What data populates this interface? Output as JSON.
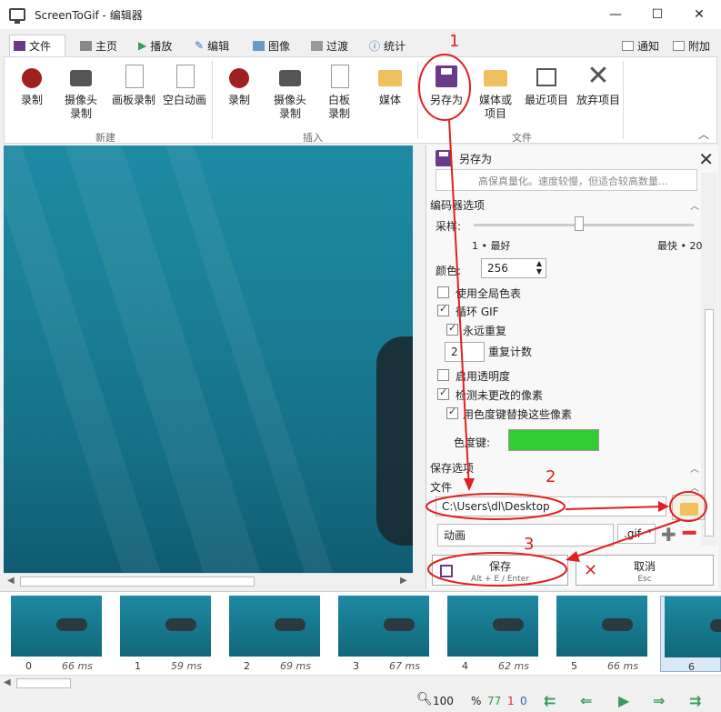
{
  "window": {
    "title": "ScreenToGif - 编辑器"
  },
  "tabs": [
    {
      "label": "文件"
    },
    {
      "label": "主页"
    },
    {
      "label": "播放"
    },
    {
      "label": "编辑"
    },
    {
      "label": "图像"
    },
    {
      "label": "过渡"
    },
    {
      "label": "统计"
    }
  ],
  "header_right": {
    "notify": "通知",
    "attach": "附加"
  },
  "ribbon": {
    "new": {
      "group": "新建",
      "items": [
        "录制",
        "摄像头\n录制",
        "画板录制",
        "空白动画"
      ]
    },
    "insert": {
      "group": "插入",
      "items": [
        "录制",
        "摄像头\n录制",
        "白板\n录制",
        "媒体"
      ]
    },
    "file": {
      "group": "文件",
      "items": [
        "另存为",
        "媒体或\n项目",
        "最近项目",
        "放弃项目"
      ]
    }
  },
  "panel": {
    "title": "另存为",
    "format_desc": "高保真量化。速度较慢，但适合较高数量...",
    "encoder_section": "编码器选项",
    "sampling_label": "采样:",
    "sampling_min": "1 • 最好",
    "sampling_max": "最快 • 20",
    "colors_label": "颜色:",
    "colors_value": "256",
    "use_global_palette": "使用全局色表",
    "loop_gif": "循环 GIF",
    "repeat_forever": "永远重复",
    "repeat_count_value": "2",
    "repeat_count_label": "重复计数",
    "enable_transparency": "启用透明度",
    "detect_unchanged": "检测未更改的像素",
    "replace_with_chroma": "用色度键替换这些像素",
    "chroma_key_label": "色度键:",
    "save_options_section": "保存选项",
    "file_section": "文件",
    "path_value": "C:\\Users\\dl\\Desktop",
    "filename_value": "动画",
    "extension_value": ".gif",
    "save_button": "保存",
    "save_shortcut": "Alt + E / Enter",
    "cancel_button": "取消",
    "cancel_shortcut": "Esc"
  },
  "frames": [
    {
      "index": "0",
      "ms": "66 ms"
    },
    {
      "index": "1",
      "ms": "59 ms"
    },
    {
      "index": "2",
      "ms": "69 ms"
    },
    {
      "index": "3",
      "ms": "67 ms"
    },
    {
      "index": "4",
      "ms": "62 ms"
    },
    {
      "index": "5",
      "ms": "66 ms"
    },
    {
      "index": "6",
      "ms": ""
    }
  ],
  "status": {
    "zoom": "100",
    "zoom_unit": "%",
    "count_green": "77",
    "count_red": "1",
    "count_blue": "0"
  },
  "annotations": {
    "n1": "1",
    "n2": "2",
    "n3": "3"
  },
  "colors": {
    "accent_red": "#e02020",
    "chroma_green": "#33cc33",
    "save_purple": "#6b3a8a"
  }
}
